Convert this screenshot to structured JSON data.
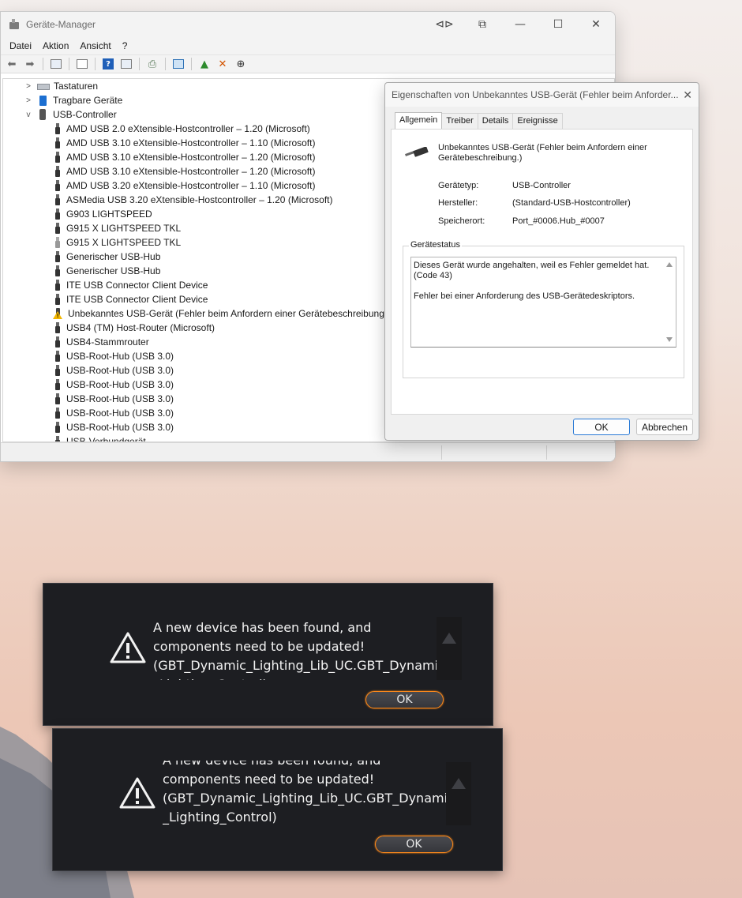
{
  "device_manager": {
    "title": "Geräte-Manager",
    "menu": [
      "Datei",
      "Aktion",
      "Ansicht",
      "?"
    ],
    "tree": {
      "categories_before": [
        {
          "label": "Tastaturen",
          "icon": "keyboard-icon"
        },
        {
          "label": "Tragbare Geräte",
          "icon": "portable-device-icon"
        }
      ],
      "usb_category": "USB-Controller",
      "usb_items": [
        "AMD USB 2.0 eXtensible-Hostcontroller – 1.20 (Microsoft)",
        "AMD USB 3.10 eXtensible-Hostcontroller – 1.10 (Microsoft)",
        "AMD USB 3.10 eXtensible-Hostcontroller – 1.20 (Microsoft)",
        "AMD USB 3.10 eXtensible-Hostcontroller – 1.20 (Microsoft)",
        "AMD USB 3.20 eXtensible-Hostcontroller – 1.10 (Microsoft)",
        "ASMedia USB 3.20 eXtensible-Hostcontroller – 1.20 (Microsoft)",
        "G903 LIGHTSPEED",
        "G915 X LIGHTSPEED TKL",
        "G915 X LIGHTSPEED TKL",
        "Generischer USB-Hub",
        "Generischer USB-Hub",
        "ITE USB Connector Client Device",
        "ITE USB Connector Client Device",
        "Unbekanntes USB-Gerät (Fehler beim Anfordern einer Gerätebeschreibung.)",
        "USB4 (TM) Host-Router (Microsoft)",
        "USB4-Stammrouter",
        "USB-Root-Hub (USB 3.0)",
        "USB-Root-Hub (USB 3.0)",
        "USB-Root-Hub (USB 3.0)",
        "USB-Root-Hub (USB 3.0)",
        "USB-Root-Hub (USB 3.0)",
        "USB-Root-Hub (USB 3.0)",
        "USB-Verbundgerät"
      ]
    }
  },
  "properties": {
    "title": "Eigenschaften von Unbekanntes USB-Gerät (Fehler beim Anforder...",
    "tabs": [
      "Allgemein",
      "Treiber",
      "Details",
      "Ereignisse"
    ],
    "device_name": "Unbekanntes USB-Gerät (Fehler beim Anfordern einer Gerätebeschreibung.)",
    "rows": [
      {
        "label": "Gerätetyp:",
        "value": "USB-Controller"
      },
      {
        "label": "Hersteller:",
        "value": "(Standard-USB-Hostcontroller)"
      },
      {
        "label": "Speicherort:",
        "value": "Port_#0006.Hub_#0007"
      }
    ],
    "status_label": "Gerätestatus",
    "status_text": "Dieses Gerät wurde angehalten, weil es Fehler gemeldet hat. (Code 43)\n\nFehler bei einer Anforderung des USB-Gerätedeskriptors.",
    "ok": "OK",
    "cancel": "Abbrechen"
  },
  "popups": [
    {
      "message": "A new device has been found, and\ncomponents need to be updated!\n(GBT_Dynamic_Lighting_Lib_UC.GBT_Dynamic\n_Lighting_Control)",
      "ok": "OK"
    },
    {
      "message": "A new device has been found, and\ncomponents need to be updated!\n(GBT_Dynamic_Lighting_Lib_UC.GBT_Dynamic\n_Lighting_Control)",
      "ok": "OK"
    }
  ],
  "colors": {
    "accent_orange": "#ff8a1a",
    "warning_yellow": "#f2b600",
    "popup_bg": "#1d1e22"
  }
}
